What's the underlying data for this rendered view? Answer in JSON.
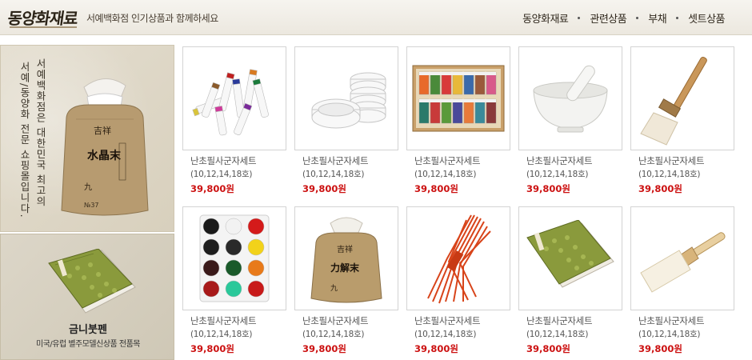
{
  "header": {
    "logo": "동양화재료",
    "tagline": "서예백화점 인기상품과 함께하세요",
    "nav": [
      "동양화재료",
      "관련상품",
      "부채",
      "셋트상품"
    ]
  },
  "side_banner": {
    "vertical_lines": [
      "서예백화점은 대한민국 최고의",
      "서예/동양화 전문 쇼핑몰입니다."
    ],
    "bag_label": "水晶末",
    "bag_top": "吉祥",
    "promo_title": "금니붓펜",
    "promo_subtitle": "미국/유럽 별주모델신상품 전품목"
  },
  "products": [
    {
      "name": "난초필사군자세트",
      "spec": "(10,12,14,18호)",
      "price": "39,800원",
      "icon": "paint-tubes"
    },
    {
      "name": "난초필사군자세트",
      "spec": "(10,12,14,18호)",
      "price": "39,800원",
      "icon": "porcelain-dishes"
    },
    {
      "name": "난초필사군자세트",
      "spec": "(10,12,14,18호)",
      "price": "39,800원",
      "icon": "pigment-jars"
    },
    {
      "name": "난초필사군자세트",
      "spec": "(10,12,14,18호)",
      "price": "39,800원",
      "icon": "mortar-pestle"
    },
    {
      "name": "난초필사군자세트",
      "spec": "(10,12,14,18호)",
      "price": "39,800원",
      "icon": "flat-brush"
    },
    {
      "name": "난초필사군자세트",
      "spec": "(10,12,14,18호)",
      "price": "39,800원",
      "icon": "paint-palette"
    },
    {
      "name": "난초필사군자세트",
      "spec": "(10,12,14,18호)",
      "price": "39,800원",
      "icon": "pigment-bag"
    },
    {
      "name": "난초필사군자세트",
      "spec": "(10,12,14,18호)",
      "price": "39,800원",
      "icon": "red-thread"
    },
    {
      "name": "난초필사군자세트",
      "spec": "(10,12,14,18호)",
      "price": "39,800원",
      "icon": "silk-book"
    },
    {
      "name": "난초필사군자세트",
      "spec": "(10,12,14,18호)",
      "price": "39,800원",
      "icon": "hake-brush"
    }
  ],
  "colors": {
    "price": "#cc1111",
    "border": "#d3d3d3",
    "banner": "#d8d0bd"
  }
}
